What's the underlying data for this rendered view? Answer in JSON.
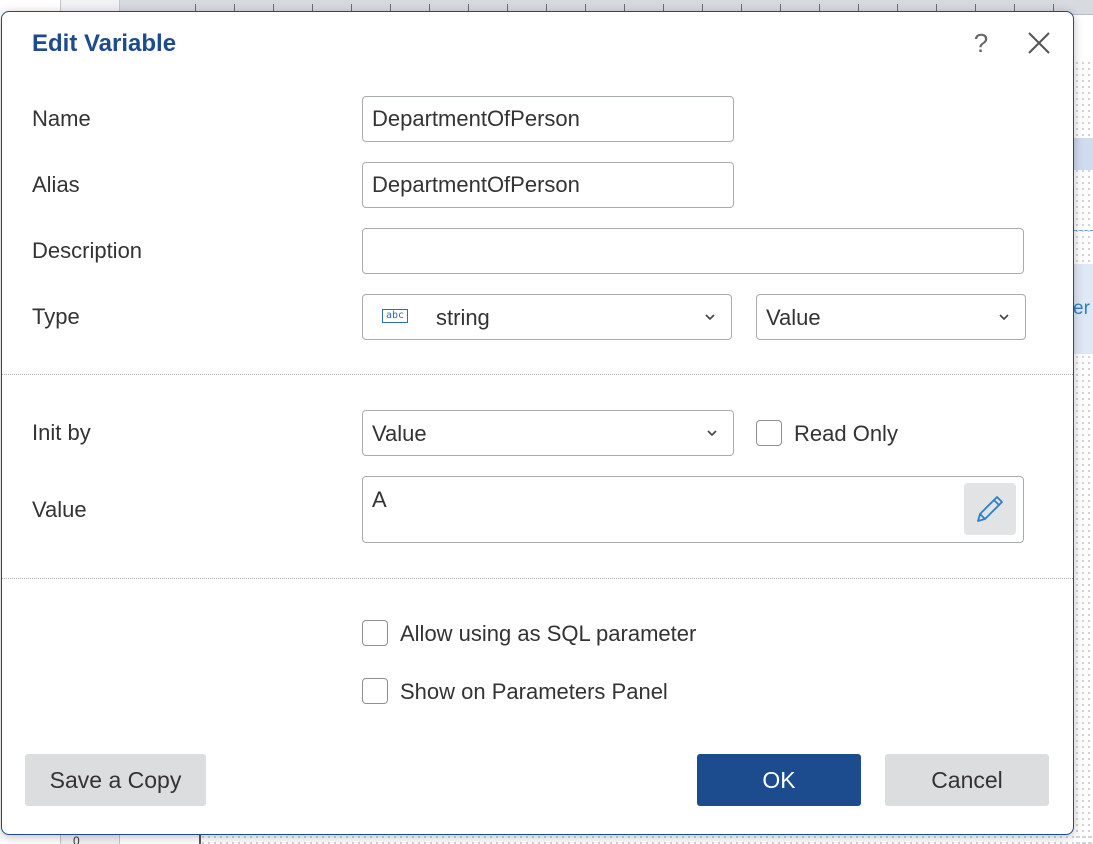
{
  "dialog": {
    "title": "Edit Variable"
  },
  "header": {
    "help_label": "?"
  },
  "fields": {
    "name_label": "Name",
    "name_value": "DepartmentOfPerson",
    "alias_label": "Alias",
    "alias_value": "DepartmentOfPerson",
    "description_label": "Description",
    "description_value": "",
    "type_label": "Type",
    "type_icon_text": "abc",
    "type_value": "string",
    "type_mode_value": "Value",
    "init_by_label": "Init by",
    "init_by_value": "Value",
    "read_only_label": "Read Only",
    "value_label": "Value",
    "value_text": "A"
  },
  "options": {
    "allow_sql_label": "Allow using as SQL parameter",
    "show_params_label": "Show on Parameters Panel"
  },
  "footer": {
    "save_copy_label": "Save a Copy",
    "ok_label": "OK",
    "cancel_label": "Cancel"
  },
  "background": {
    "ruler_left_number": "0",
    "band_text": "er"
  },
  "colors": {
    "accent": "#1c4b8e",
    "border": "#a8abb0",
    "button_gray": "#dcdddf"
  }
}
